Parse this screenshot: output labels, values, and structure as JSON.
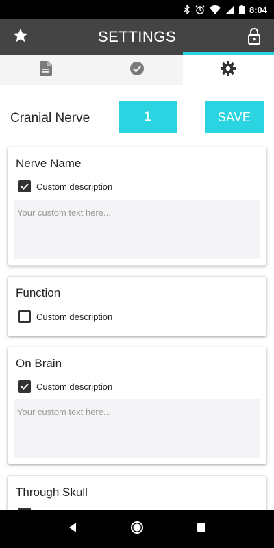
{
  "status_bar": {
    "time": "8:04",
    "icons": [
      "bluetooth-icon",
      "alarm-icon",
      "wifi-icon",
      "signal-icon",
      "battery-icon"
    ]
  },
  "app_bar": {
    "title": "SETTINGS",
    "left_icon": "star-icon",
    "right_icon": "lock-icon"
  },
  "tabs": [
    {
      "icon": "document-icon",
      "active": false
    },
    {
      "icon": "check-circle-icon",
      "active": false
    },
    {
      "icon": "gear-icon",
      "active": true
    }
  ],
  "nerve": {
    "label": "Cranial Nerve",
    "value": "1",
    "save_label": "SAVE"
  },
  "cards": [
    {
      "title": "Nerve Name",
      "checkbox_label": "Custom description",
      "checked": true,
      "placeholder": "Your custom text here..."
    },
    {
      "title": "Function",
      "checkbox_label": "Custom description",
      "checked": false
    },
    {
      "title": "On Brain",
      "checkbox_label": "Custom description",
      "checked": true,
      "placeholder": "Your custom text here..."
    },
    {
      "title": "Through Skull"
    }
  ],
  "colors": {
    "accent": "#2ad4e0",
    "app_bar": "#444444",
    "tab_bar": "#f4f4f5",
    "textarea_bg": "#f4f4f6"
  },
  "nav_bar": {
    "icons": [
      "back-icon",
      "home-icon",
      "recents-icon"
    ]
  }
}
